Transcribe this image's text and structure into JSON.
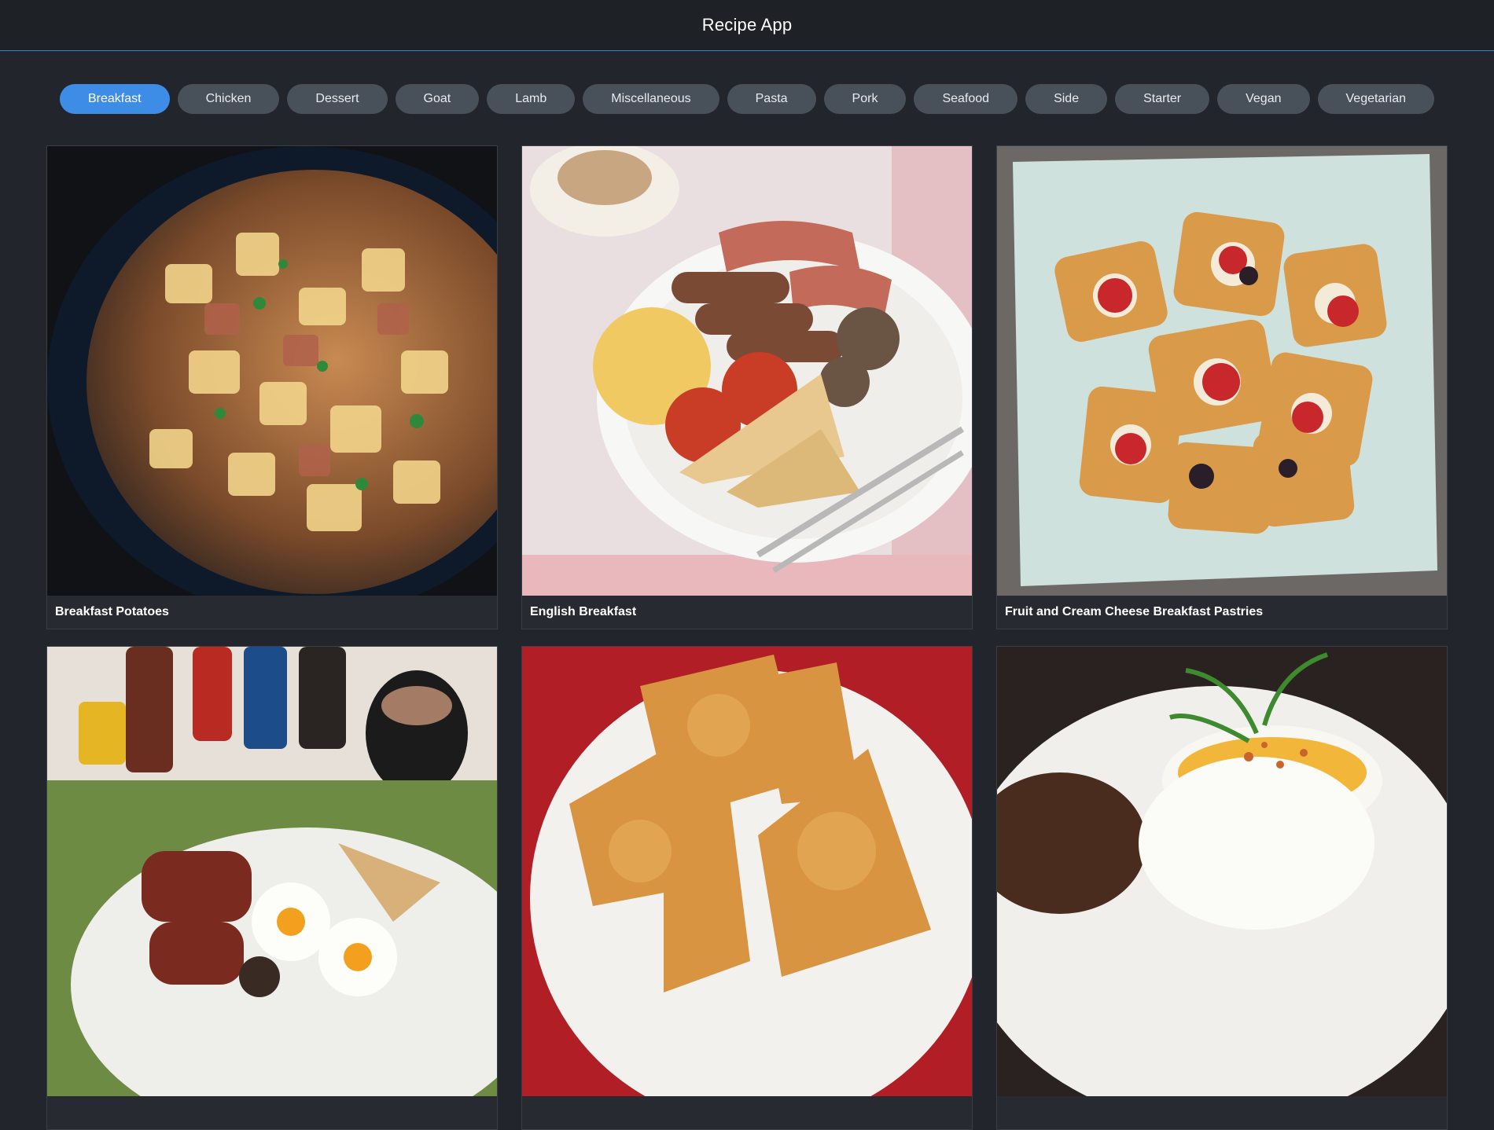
{
  "app": {
    "title": "Recipe App"
  },
  "categories": [
    {
      "label": "Breakfast",
      "active": true
    },
    {
      "label": "Chicken"
    },
    {
      "label": "Dessert"
    },
    {
      "label": "Goat"
    },
    {
      "label": "Lamb"
    },
    {
      "label": "Miscellaneous"
    },
    {
      "label": "Pasta"
    },
    {
      "label": "Pork"
    },
    {
      "label": "Seafood"
    },
    {
      "label": "Side"
    },
    {
      "label": "Starter"
    },
    {
      "label": "Vegan"
    },
    {
      "label": "Vegetarian"
    }
  ],
  "colors": {
    "accent": "#3d8ce6",
    "chip": "#48505a",
    "background": "#22262c"
  },
  "recipes": [
    {
      "title": "Breakfast Potatoes"
    },
    {
      "title": "English Breakfast"
    },
    {
      "title": "Fruit and Cream Cheese Breakfast Pastries"
    },
    {
      "title": ""
    },
    {
      "title": ""
    },
    {
      "title": ""
    }
  ]
}
